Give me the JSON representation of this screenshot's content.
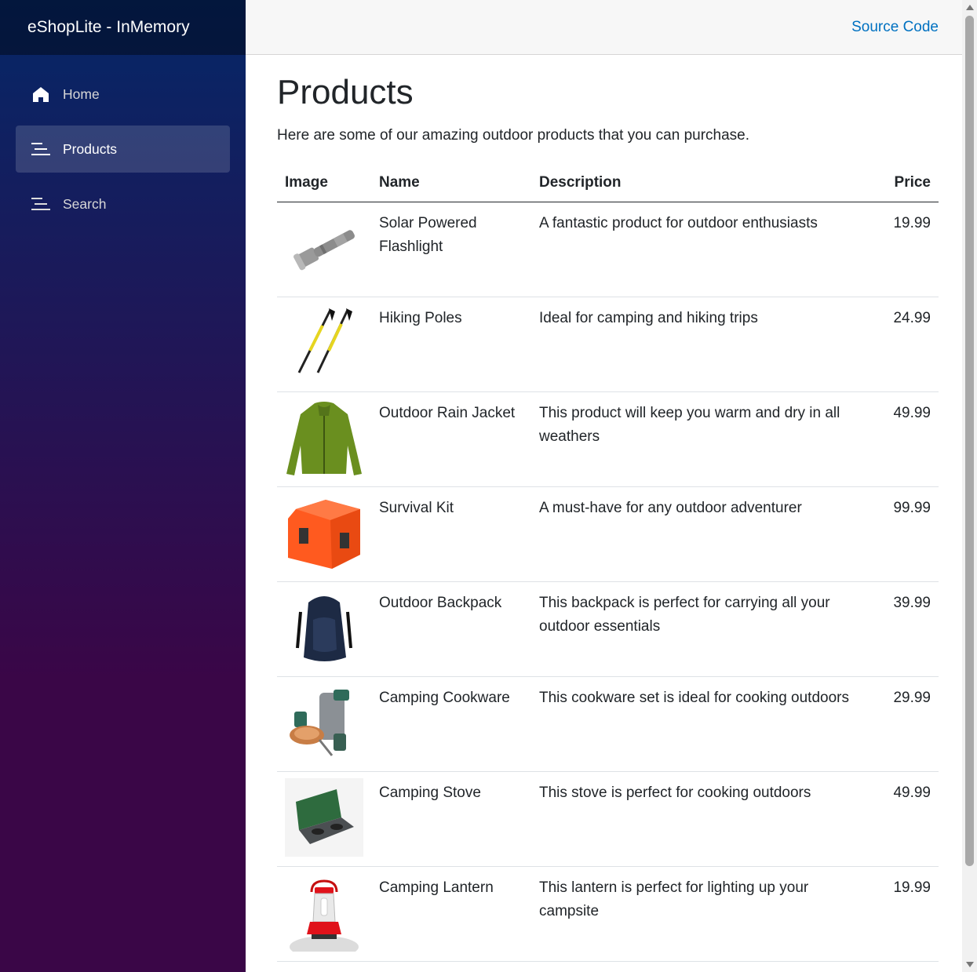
{
  "app": {
    "brand": "eShopLite - InMemory"
  },
  "topbar": {
    "source_link": "Source Code"
  },
  "nav": {
    "items": [
      {
        "label": "Home",
        "icon": "home-icon",
        "active": false
      },
      {
        "label": "Products",
        "icon": "list-icon",
        "active": true
      },
      {
        "label": "Search",
        "icon": "list-icon",
        "active": false
      }
    ]
  },
  "page": {
    "title": "Products",
    "intro": "Here are some of our amazing outdoor products that you can purchase."
  },
  "table": {
    "headers": {
      "image": "Image",
      "name": "Name",
      "description": "Description",
      "price": "Price"
    },
    "rows": [
      {
        "name": "Solar Powered Flashlight",
        "description": "A fantastic product for outdoor enthusiasts",
        "price": "19.99",
        "image": "flashlight-image"
      },
      {
        "name": "Hiking Poles",
        "description": "Ideal for camping and hiking trips",
        "price": "24.99",
        "image": "hiking-poles-image"
      },
      {
        "name": "Outdoor Rain Jacket",
        "description": "This product will keep you warm and dry in all weathers",
        "price": "49.99",
        "image": "rain-jacket-image"
      },
      {
        "name": "Survival Kit",
        "description": "A must-have for any outdoor adventurer",
        "price": "99.99",
        "image": "survival-kit-image"
      },
      {
        "name": "Outdoor Backpack",
        "description": "This backpack is perfect for carrying all your outdoor essentials",
        "price": "39.99",
        "image": "backpack-image"
      },
      {
        "name": "Camping Cookware",
        "description": "This cookware set is ideal for cooking outdoors",
        "price": "29.99",
        "image": "cookware-image"
      },
      {
        "name": "Camping Stove",
        "description": "This stove is perfect for cooking outdoors",
        "price": "49.99",
        "image": "camping-stove-image"
      },
      {
        "name": "Camping Lantern",
        "description": "This lantern is perfect for lighting up your campsite",
        "price": "19.99",
        "image": "lantern-image"
      }
    ]
  },
  "colors": {
    "sidebar_top": "#052767",
    "sidebar_bottom": "#3a0647",
    "link": "#0071c1",
    "topbar_bg": "#f7f7f7"
  }
}
